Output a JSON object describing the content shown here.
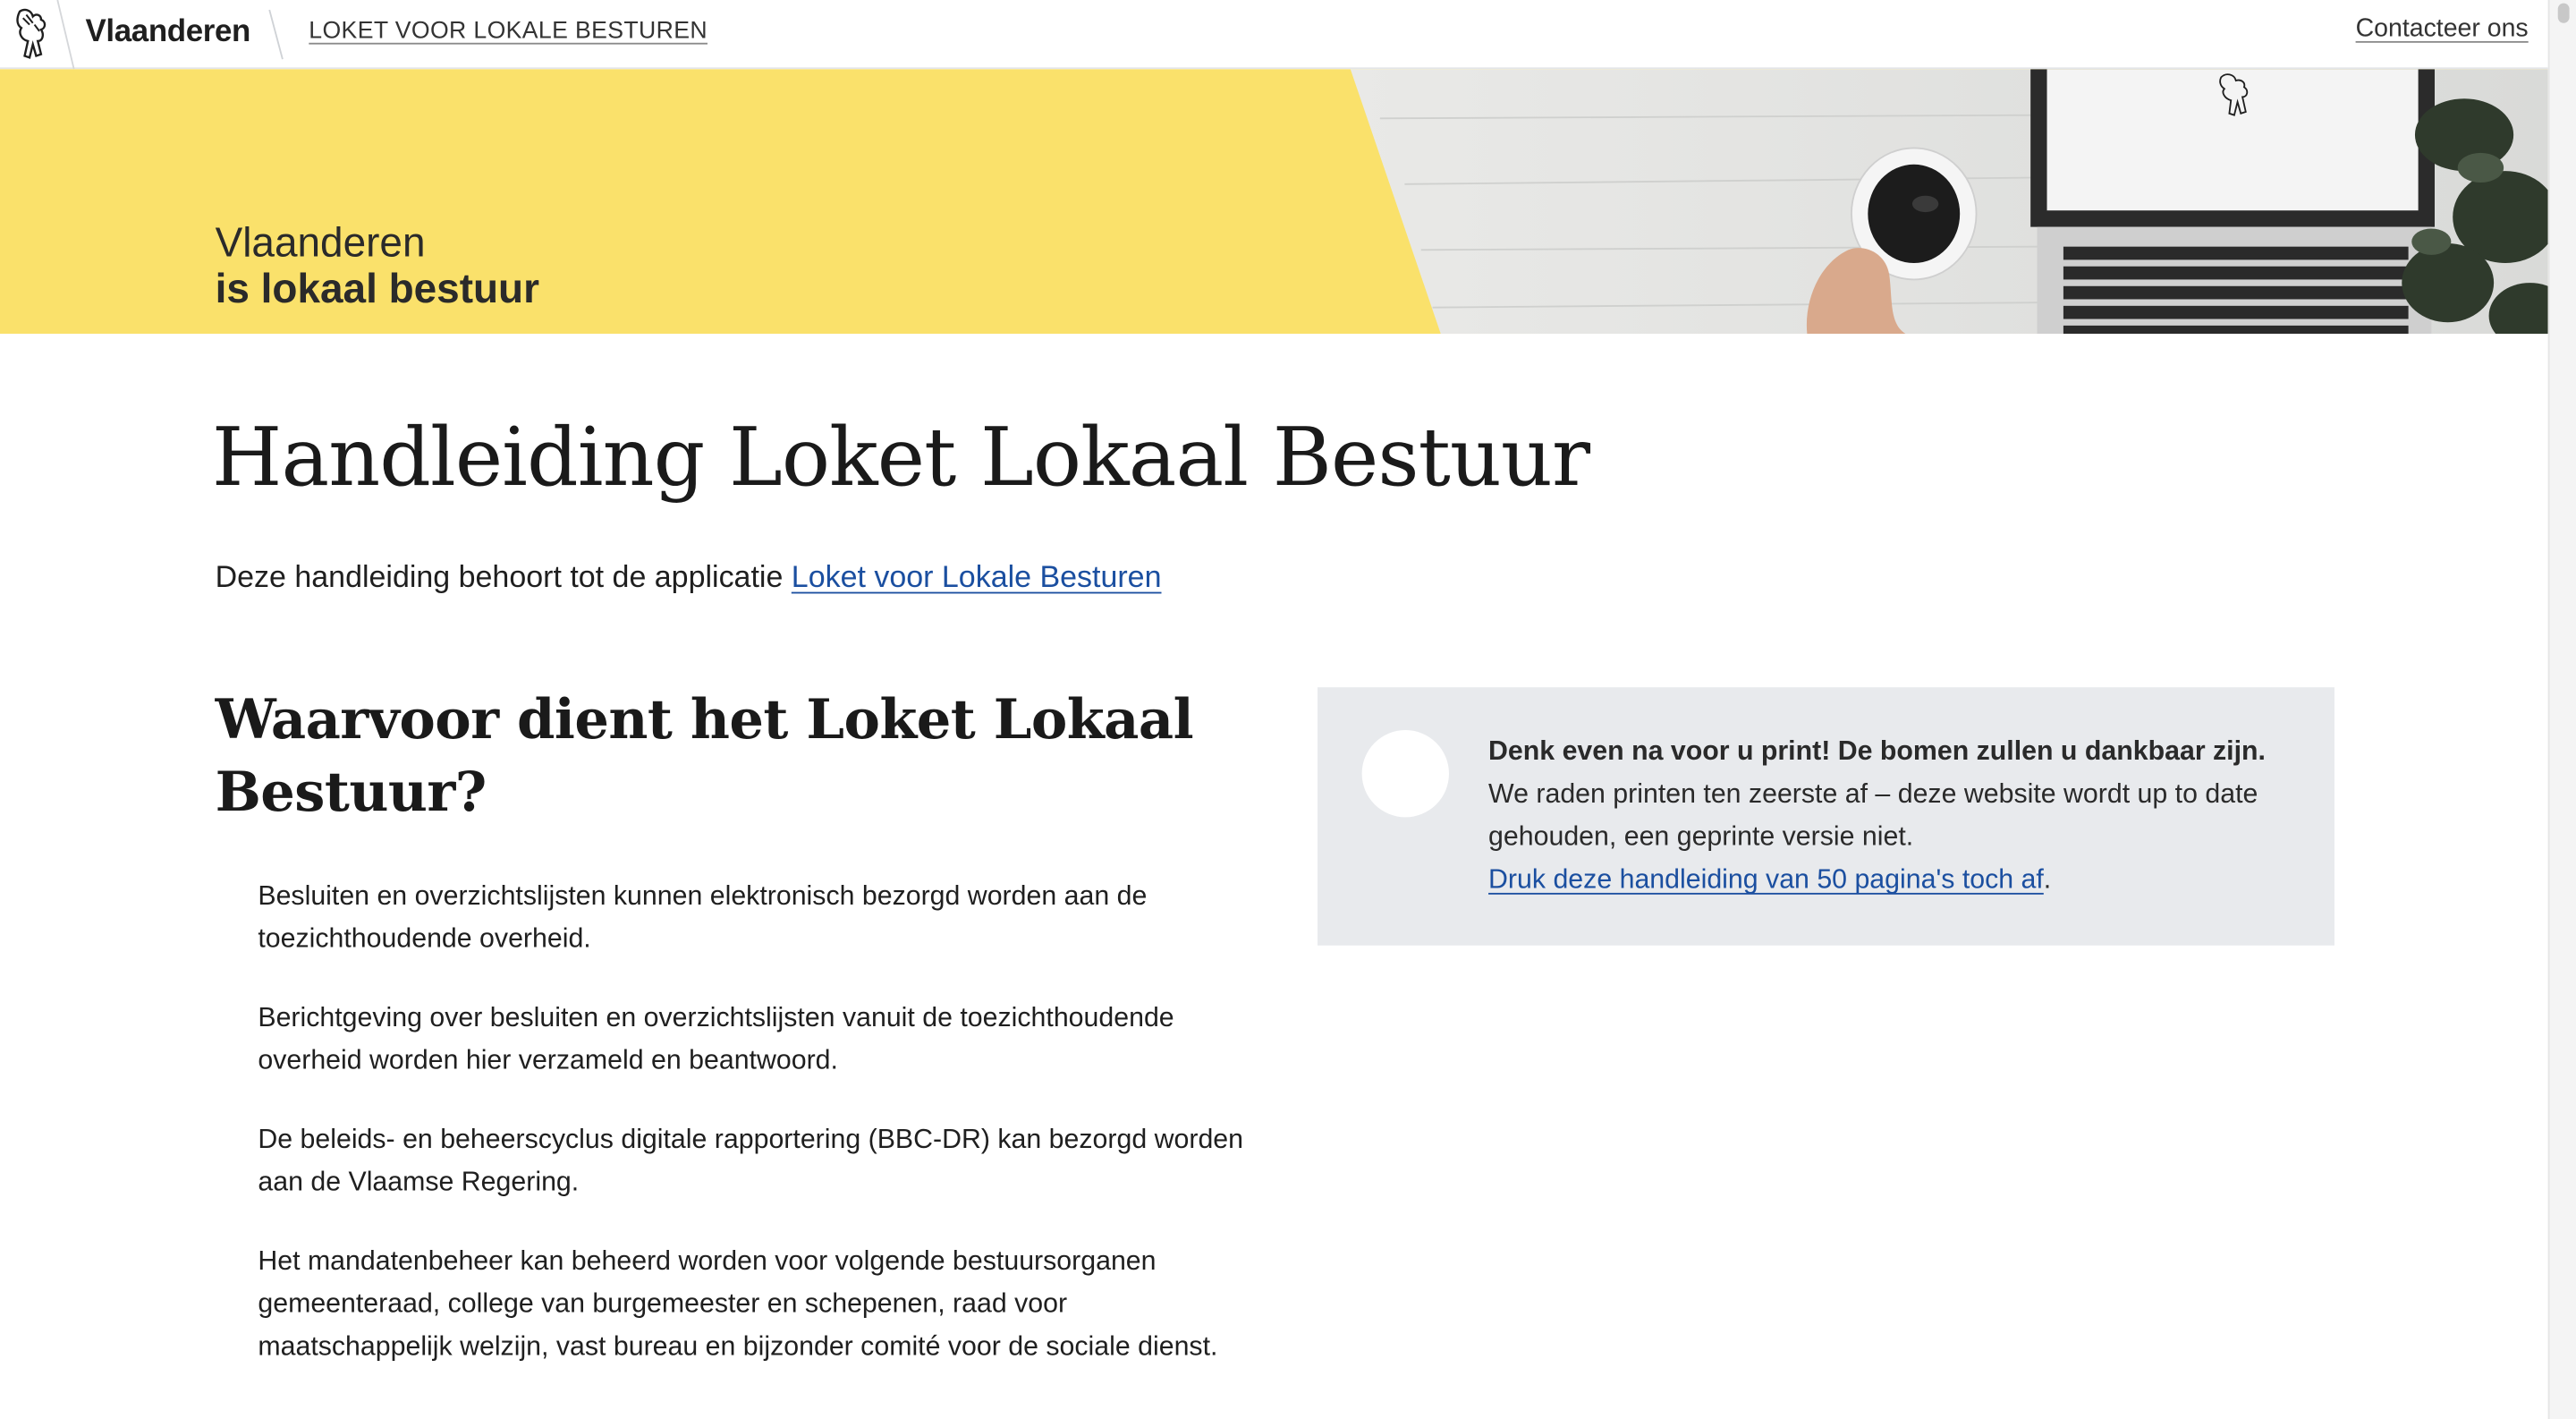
{
  "header": {
    "brand": "Vlaanderen",
    "app_link": "LOKET VOOR LOKALE BESTUREN",
    "contact": "Contacteer ons"
  },
  "hero": {
    "line1": "Vlaanderen",
    "line2": "is lokaal bestuur"
  },
  "main": {
    "title": "Handleiding Loket Lokaal Bestuur",
    "intro_text": "Deze handleiding behoort tot de applicatie ",
    "intro_link": "Loket voor Lokale Besturen",
    "section_title": "Waarvoor dient het Loket Lokaal Bestuur?",
    "features": [
      "Besluiten en overzichtslijsten kunnen elektronisch bezorgd worden aan de toezichthoudende overheid.",
      "Berichtgeving over besluiten en overzichtslijsten vanuit de toezichthoudende overheid worden hier verzameld en beantwoord.",
      "De beleids- en beheerscyclus digitale rapportering (BBC-DR) kan bezorgd worden aan de Vlaamse Regering.",
      "Het mandatenbeheer kan beheerd worden voor volgende bestuursorganen gemeenteraad, college van burgemeester en schepenen, raad voor maatschappelijk welzijn, vast bureau en bijzonder comité voor de sociale dienst."
    ]
  },
  "notice": {
    "title": "Denk even na voor u print! De bomen zullen u dankbaar zijn.",
    "body": "We raden printen ten zeerste af – deze website wordt up to date gehouden, een geprinte versie niet.",
    "link": "Druk deze handleiding van 50 pagina's toch af",
    "link_suffix": "."
  },
  "colors": {
    "accent_yellow": "#fae16b",
    "link_blue": "#1b4fa0",
    "notice_bg": "#e8eaed"
  }
}
